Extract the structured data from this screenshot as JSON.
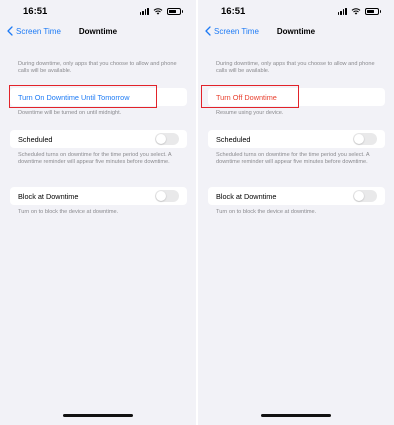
{
  "status_bar": {
    "time": "16:51"
  },
  "nav": {
    "back_label": "Screen Time",
    "title": "Downtime"
  },
  "left": {
    "intro": "During downtime, only apps that you choose to allow and phone calls will be available.",
    "action_label": "Turn On Downtime Until Tomorrow",
    "action_footer": "Downtime will be turned on until midnight.",
    "scheduled_label": "Scheduled",
    "scheduled_on": false,
    "scheduled_footer": "Scheduled turns on downtime for the time period you select. A downtime reminder will appear five minutes before downtime.",
    "block_label": "Block at Downtime",
    "block_on": false,
    "block_footer": "Turn on to block the device at downtime."
  },
  "right": {
    "intro": "During downtime, only apps that you choose to allow and phone calls will be available.",
    "action_label": "Turn Off Downtime",
    "action_footer": "Resume using your device.",
    "scheduled_label": "Scheduled",
    "scheduled_on": false,
    "scheduled_footer": "Scheduled turns on downtime for the time period you select. A downtime reminder will appear five minutes before downtime.",
    "block_label": "Block at Downtime",
    "block_on": false,
    "block_footer": "Turn on to block the device at downtime."
  },
  "colors": {
    "accent_blue": "#1e7bf5",
    "destructive_red": "#e8402f",
    "annotation_box": "#e2232a",
    "background": "#f2f2f7"
  }
}
